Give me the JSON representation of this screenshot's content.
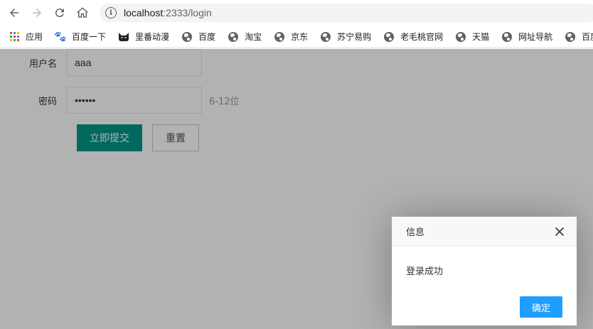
{
  "browser": {
    "url_host": "localhost",
    "url_path": ":2333/login"
  },
  "bookmarks": [
    {
      "label": "应用",
      "icon": "apps-grid-icon"
    },
    {
      "label": "百度一下",
      "icon": "baidu-paw-icon"
    },
    {
      "label": "里番动漫",
      "icon": "cat-icon"
    },
    {
      "label": "百度",
      "icon": "globe-icon"
    },
    {
      "label": "淘宝",
      "icon": "globe-icon"
    },
    {
      "label": "京东",
      "icon": "globe-icon"
    },
    {
      "label": "苏宁易购",
      "icon": "globe-icon"
    },
    {
      "label": "老毛桃官网",
      "icon": "globe-icon"
    },
    {
      "label": "天猫",
      "icon": "globe-icon"
    },
    {
      "label": "网址导航",
      "icon": "globe-icon"
    },
    {
      "label": "百度翻",
      "icon": "globe-icon"
    }
  ],
  "form": {
    "username_label": "用户名",
    "username_value": "aaa",
    "password_label": "密码",
    "password_value": "••••••",
    "password_hint": "6-12位",
    "submit_label": "立即提交",
    "reset_label": "重置"
  },
  "dialog": {
    "title": "信息",
    "message": "登录成功",
    "ok_label": "确定"
  },
  "colors": {
    "primary": "#009688",
    "dialog_button": "#1e9fff",
    "overlay": "rgba(0,0,0,0.3)"
  }
}
